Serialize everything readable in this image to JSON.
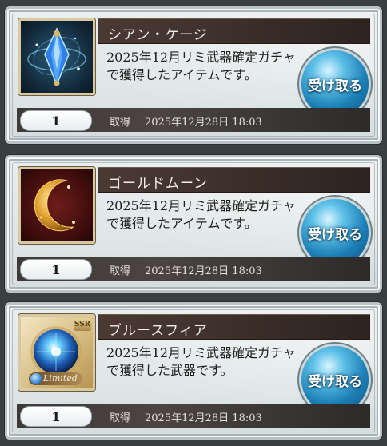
{
  "items": [
    {
      "name": "シアン・ケージ",
      "description": "2025年12月リミ武器確定ガチャで獲得したアイテムです。",
      "quantity": "1",
      "acquired_label": "取得",
      "acquired_date": "2025年12月28日 18:03",
      "button_label": "受け取る",
      "icon": "blue-crystal-icon"
    },
    {
      "name": "ゴールドムーン",
      "description": "2025年12月リミ武器確定ガチャで獲得したアイテムです。",
      "quantity": "1",
      "acquired_label": "取得",
      "acquired_date": "2025年12月28日 18:03",
      "button_label": "受け取る",
      "icon": "gold-crescent-moon-icon"
    },
    {
      "name": "ブルースフィア",
      "description": "2025年12月リミ武器確定ガチャで獲得した武器です。",
      "quantity": "1",
      "acquired_label": "取得",
      "acquired_date": "2025年12月28日 18:03",
      "button_label": "受け取る",
      "icon": "blue-sphere-weapon-icon",
      "rarity": "SSR",
      "badge": "Limited"
    }
  ],
  "colors": {
    "title_bar": "#3a2d28",
    "button_blue": "#1c7fb6",
    "card_bg": "#e3e9ea"
  }
}
